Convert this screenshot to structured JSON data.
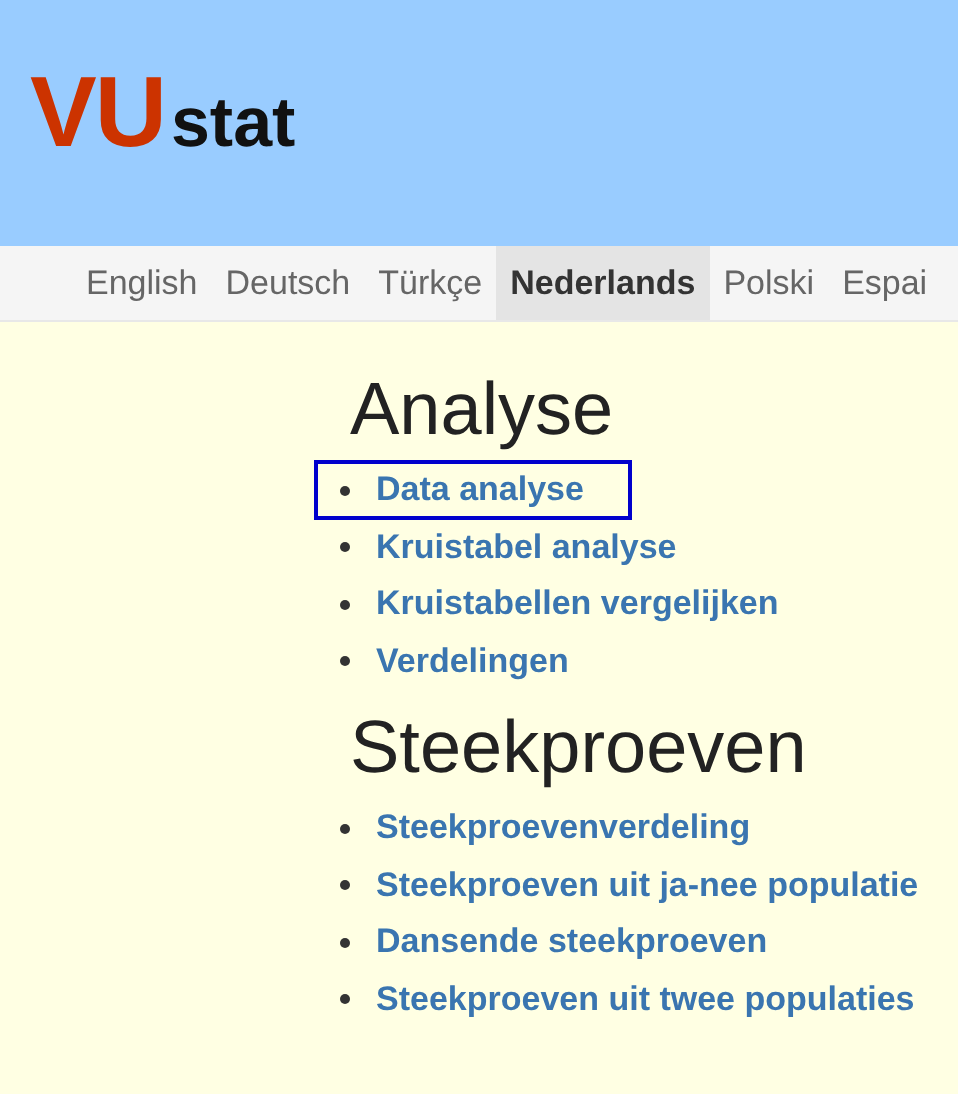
{
  "logo": {
    "part_1": "VU",
    "part_2": "stat"
  },
  "languages": [
    {
      "label": "English",
      "selected": false
    },
    {
      "label": "Deutsch",
      "selected": false
    },
    {
      "label": "Türkçe",
      "selected": false
    },
    {
      "label": "Nederlands",
      "selected": true
    },
    {
      "label": "Polski",
      "selected": false
    },
    {
      "label": "Espai",
      "selected": false
    }
  ],
  "sections": [
    {
      "heading": "Analyse",
      "links": [
        {
          "label": "Data analyse",
          "selected": true
        },
        {
          "label": "Kruistabel analyse",
          "selected": false
        },
        {
          "label": "Kruistabellen vergelijken",
          "selected": false
        },
        {
          "label": "Verdelingen",
          "selected": false
        }
      ]
    },
    {
      "heading": "Steekproeven",
      "links": [
        {
          "label": "Steekproevenverdeling",
          "selected": false
        },
        {
          "label": "Steekproeven uit ja-nee populatie",
          "selected": false
        },
        {
          "label": "Dansende steekproeven",
          "selected": false
        },
        {
          "label": "Steekproeven uit twee populaties",
          "selected": false
        }
      ]
    }
  ]
}
